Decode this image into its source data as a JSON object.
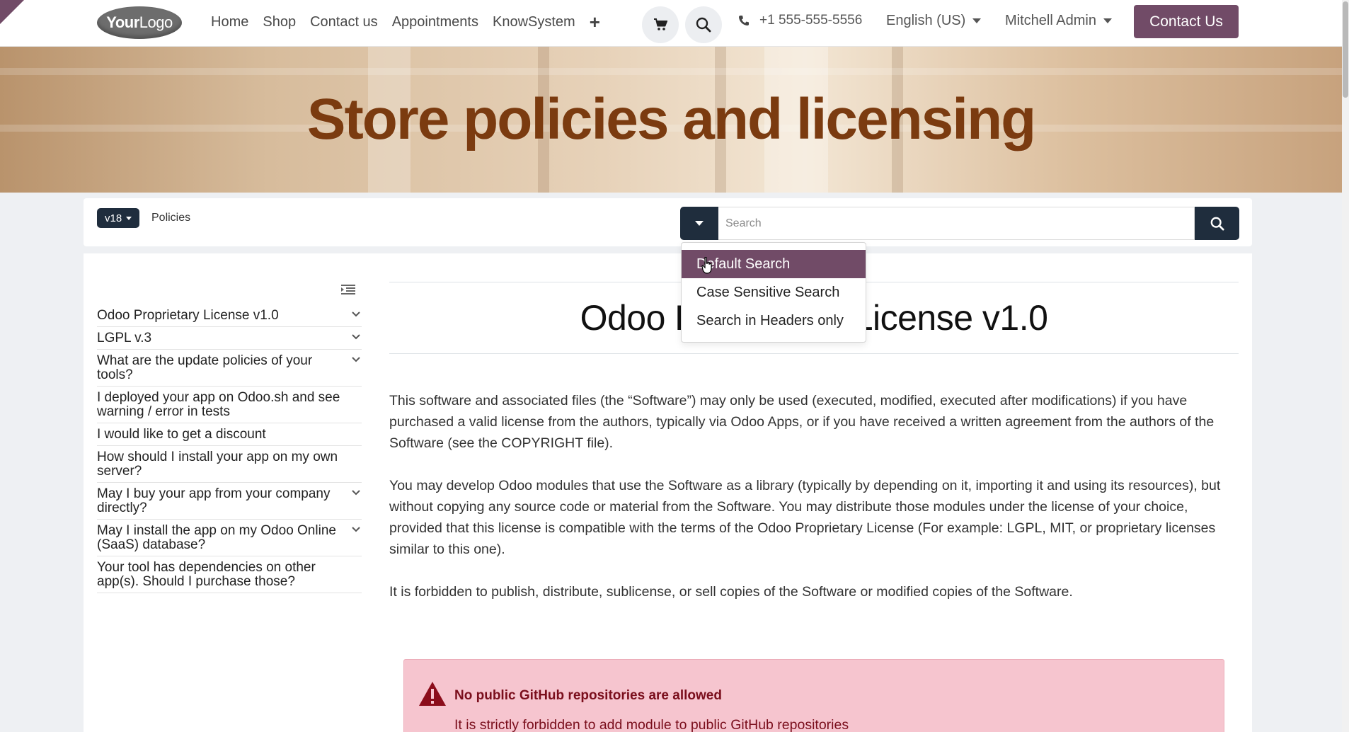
{
  "colors": {
    "brand": "#714b67",
    "dark": "#1f2d3d",
    "hero_title": "#7b3b10",
    "alert_bg": "#f6c5cf",
    "alert_text": "#7a0e1c"
  },
  "navbar": {
    "logo_bold": "Your",
    "logo_light": "Logo",
    "links": [
      "Home",
      "Shop",
      "Contact us",
      "Appointments",
      "KnowSystem"
    ],
    "plus_icon": "plus-icon",
    "cart_icon": "cart-icon",
    "search_icon": "search-icon",
    "phone_icon": "phone-icon",
    "phone": "+1 555-555-5556",
    "language": "English (US)",
    "user": "Mitchell Admin",
    "cta": "Contact Us"
  },
  "hero": {
    "title": "Store policies and licensing"
  },
  "search": {
    "version": "v18",
    "breadcrumb": "Policies",
    "placeholder": "Search",
    "value": "",
    "mode_options": [
      "Default Search",
      "Case Sensitive Search",
      "Search in Headers only"
    ],
    "selected_mode": "Default Search"
  },
  "toc": {
    "items": [
      {
        "label": "Odoo Proprietary License v1.0",
        "expandable": true
      },
      {
        "label": "LGPL v.3",
        "expandable": true
      },
      {
        "label": "What are the update policies of your tools?",
        "expandable": true
      },
      {
        "label": "I deployed your app on Odoo.sh and see warning / error in tests",
        "expandable": false
      },
      {
        "label": "I would like to get a discount",
        "expandable": false
      },
      {
        "label": "How should I install your app on my own server?",
        "expandable": false
      },
      {
        "label": "May I buy your app from your company directly?",
        "expandable": true
      },
      {
        "label": "May I install the app on my Odoo Online (SaaS) database?",
        "expandable": true
      },
      {
        "label": "Your tool has dependencies on other app(s). Should I purchase those?",
        "expandable": false
      }
    ]
  },
  "article": {
    "title": "Odoo Proprietary License v1.0",
    "paragraphs": [
      "This software and associated files (the “Software”) may only be used (executed, modified, executed after modifications) if you have purchased a valid license from the authors, typically via Odoo Apps, or if you have received a written agreement from the authors of the Software (see the COPYRIGHT file).",
      "You may develop Odoo modules that use the Software as a library (typically by depending on it, importing it and using its resources), but without copying any source code or material from the Software. You may distribute those modules under the license of your choice, provided that this license is compatible with the terms of the Odoo Proprietary License (For example: LGPL, MIT, or proprietary licenses similar to this one).",
      "It is forbidden to publish, distribute, sublicense, or sell copies of the Software or modified copies of the Software."
    ],
    "alert": {
      "icon": "warning-icon",
      "title": "No public GitHub repositories are allowed",
      "text": "It is strictly forbidden to add module to public GitHub repositories"
    }
  }
}
